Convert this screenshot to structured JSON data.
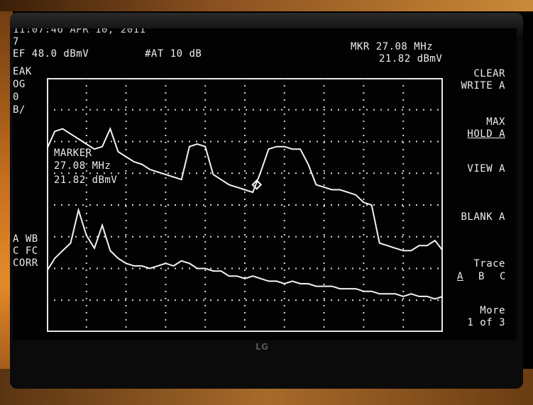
{
  "header": {
    "datetime": "11:07:46 APR 10, 2011",
    "row2_frag": "7",
    "ref_level": "EF 48.0 dBmV",
    "attenuation": "#AT 10 dB",
    "marker_readout_freq": "MKR 27.08 MHz",
    "marker_readout_amp": "21.82 dBmV"
  },
  "left_labels": [
    "EAK",
    "OG",
    "0",
    "B/"
  ],
  "left_bottom_labels": [
    "A WB",
    "C FC",
    "CORR"
  ],
  "marker_box": {
    "title": "MARKER",
    "freq": "27.08 MHz",
    "amp": "21.82 dBmV"
  },
  "softkeys": {
    "clear_write": {
      "line1": "CLEAR",
      "line2": "WRITE A"
    },
    "max_hold": {
      "line1": "MAX",
      "line2": "HOLD A"
    },
    "view": "VIEW A",
    "blank": "BLANK A",
    "trace": {
      "line1": "Trace",
      "opt_a": "A",
      "opt_b": "B",
      "opt_c": "C"
    },
    "more": {
      "line1": "More",
      "line2": "1 of 3"
    }
  },
  "brand": "LG",
  "colors": {
    "trace": "#f2f2f2",
    "screen": "#020202",
    "bezel": "#0b0b0b"
  },
  "chart_data": {
    "type": "line",
    "grid": true,
    "series": [
      {
        "x": [
          0,
          2,
          4,
          6,
          8,
          10,
          12,
          14,
          16,
          18,
          20,
          22,
          24,
          26,
          28,
          30,
          32,
          34,
          36,
          38,
          40,
          42,
          44,
          46,
          48,
          50,
          52,
          54,
          56,
          58,
          60,
          62,
          64,
          66,
          68,
          70,
          72,
          74,
          76,
          78,
          80,
          82,
          84,
          86,
          88,
          90,
          92,
          94,
          96,
          98,
          100
        ],
        "y": [
          72,
          79,
          80,
          78,
          76,
          74,
          72,
          73,
          80,
          71,
          69,
          67,
          66,
          64,
          63,
          62,
          61,
          60,
          73,
          74,
          73,
          62,
          60,
          58,
          57,
          56,
          55,
          63,
          72,
          73,
          73,
          72,
          72,
          66,
          58,
          57,
          56,
          56,
          55,
          54,
          51,
          50,
          35,
          34,
          33,
          32,
          32,
          34,
          34,
          36,
          32
        ]
      },
      {
        "x": [
          0,
          2,
          4,
          6,
          8,
          10,
          12,
          14,
          16,
          18,
          20,
          22,
          24,
          26,
          28,
          30,
          32,
          34,
          36,
          38,
          40,
          42,
          44,
          46,
          48,
          50,
          52,
          54,
          56,
          58,
          60,
          62,
          64,
          66,
          68,
          70,
          72,
          74,
          76,
          78,
          80,
          82,
          84,
          86,
          88,
          90,
          92,
          94,
          96,
          98,
          100
        ],
        "y": [
          24,
          29,
          32,
          35,
          48,
          38,
          33,
          42,
          32,
          29,
          27,
          26,
          26,
          25,
          26,
          27,
          26,
          28,
          27,
          25,
          25,
          24,
          24,
          22,
          22,
          21,
          22,
          21,
          20,
          20,
          19,
          20,
          19,
          19,
          18,
          18,
          18,
          17,
          17,
          17,
          16,
          16,
          15,
          15,
          15,
          14,
          15,
          14,
          14,
          13,
          14
        ]
      }
    ],
    "markers": [
      {
        "x": 53,
        "y": 58
      }
    ],
    "ylim": [
      0,
      100
    ],
    "xlim": [
      0,
      100
    ]
  }
}
